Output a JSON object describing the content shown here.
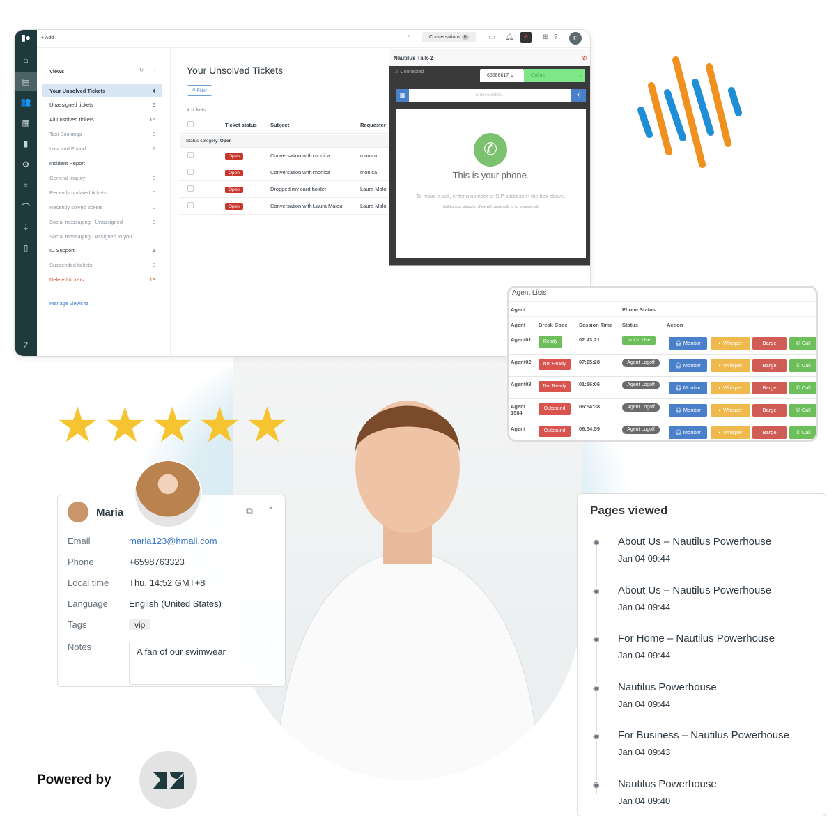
{
  "topbar": {
    "add_label": "+ Add",
    "conversations_label": "Conversations",
    "conversations_count": "0",
    "avatar_initial": "E"
  },
  "views": {
    "title": "Views",
    "items": [
      {
        "label": "Your Unsolved Tickets",
        "count": "4"
      },
      {
        "label": "Unassigned tickets",
        "count": "5"
      },
      {
        "label": "All unsolved tickets",
        "count": "16"
      },
      {
        "label": "Taxi Bookings",
        "count": "0"
      },
      {
        "label": "Lost and Found",
        "count": "2"
      },
      {
        "label": "Incident Report",
        "count": ""
      },
      {
        "label": "General Inquiry",
        "count": "0"
      },
      {
        "label": "Recently updated tickets",
        "count": "0"
      },
      {
        "label": "Recently solved tickets",
        "count": "0"
      },
      {
        "label": "Social messaging - Unassigned",
        "count": "0"
      },
      {
        "label": "Social messaging - Assigned to you",
        "count": "0"
      },
      {
        "label": "ID Support",
        "count": "1"
      },
      {
        "label": "Suspended tickets",
        "count": "0"
      },
      {
        "label": "Deleted tickets",
        "count": "13"
      }
    ],
    "manage_label": "Manage views"
  },
  "tickets": {
    "title": "Your Unsolved Tickets",
    "filter_label": "Filter",
    "count_label": "4 tickets",
    "columns": [
      "Ticket status",
      "Subject",
      "Requester"
    ],
    "category_label": "Status category:",
    "category_value": "Open",
    "rows": [
      {
        "status": "Open",
        "subject": "Conversation with monica",
        "requester": "monica"
      },
      {
        "status": "Open",
        "subject": "Conversation with monica",
        "requester": "monica"
      },
      {
        "status": "Open",
        "subject": "Dropped my card holder",
        "requester": "Laura Malo"
      },
      {
        "status": "Open",
        "subject": "Conversation with Laura Malou",
        "requester": "Laura Malo"
      }
    ]
  },
  "phone": {
    "title": "Nautilus Talk-2",
    "connection": "Connected",
    "number": "68566617",
    "status": "Online",
    "input_placeholder": "Enter number...",
    "headline": "This is your phone.",
    "hint": "To make a call, enter a number or SIP address in the box above.",
    "subhint": "Setting your status to offline will cause calls to go to voicemail.",
    "status_color": "#7ee787"
  },
  "agents": {
    "title": "Agent Lists",
    "group_agent": "Agent",
    "group_phone": "Phone Status",
    "columns": [
      "Agent",
      "Break Code",
      "Session Time",
      "Status",
      "Action"
    ],
    "rows": [
      {
        "agent": "Agent01",
        "break": "Ready",
        "break_color": "#6cbf5a",
        "time": "02:43:21",
        "status": "Not In Use",
        "status_color": "#6cbf5a"
      },
      {
        "agent": "Agent02",
        "break": "Not Ready",
        "break_color": "#d9534f",
        "time": "07:25:28",
        "status": "Agent Logoff",
        "status_color": "#6b6b6b"
      },
      {
        "agent": "Agent03",
        "break": "Not Ready",
        "break_color": "#d9534f",
        "time": "01:56:06",
        "status": "Agent Logoff",
        "status_color": "#6b6b6b"
      },
      {
        "agent": "Agent 1584",
        "break": "Outbound",
        "break_color": "#d9534f",
        "time": "06:54:38",
        "status": "Agent Logoff",
        "status_color": "#6b6b6b"
      },
      {
        "agent": "Agent",
        "break": "Outbound",
        "break_color": "#d9534f",
        "time": "06:54:59",
        "status": "Agent Logoff",
        "status_color": "#6b6b6b"
      }
    ],
    "actions": {
      "monitor": "Monitor",
      "whisper": "Whisper",
      "barge": "Barge",
      "call": "Call"
    }
  },
  "rating": {
    "stars": 5,
    "max": 5
  },
  "contact": {
    "name": "Maria",
    "fields": [
      {
        "label": "Email",
        "value": "maria123@hmail.com"
      },
      {
        "label": "Phone",
        "value": "+6598763323"
      },
      {
        "label": "Local time",
        "value": "Thu, 14:52 GMT+8"
      },
      {
        "label": "Language",
        "value": "English (United States)"
      }
    ],
    "tags_label": "Tags",
    "tag": "vip",
    "notes_label": "Notes",
    "notes": "A fan of our swimwear"
  },
  "pages_viewed": {
    "title": "Pages viewed",
    "items": [
      {
        "title": "About Us – Nautilus Powerhouse",
        "time": "Jan 04 09:44"
      },
      {
        "title": "About Us – Nautilus Powerhouse",
        "time": "Jan 04 09:44"
      },
      {
        "title": "For Home – Nautilus Powerhouse",
        "time": "Jan 04 09:44"
      },
      {
        "title": "Nautilus Powerhouse",
        "time": "Jan 04 09:44"
      },
      {
        "title": "For Business – Nautilus Powerhouse",
        "time": "Jan 04 09:43"
      },
      {
        "title": "Nautilus Powerhouse",
        "time": "Jan 04 09:40"
      }
    ]
  },
  "footer": {
    "powered_by": "Powered by"
  },
  "colors": {
    "brand_orange": "#f0901e",
    "brand_blue": "#1e8fd6",
    "zendesk_rail": "#1f3a3d",
    "open_badge": "#c8362b",
    "star": "#f6c431"
  }
}
